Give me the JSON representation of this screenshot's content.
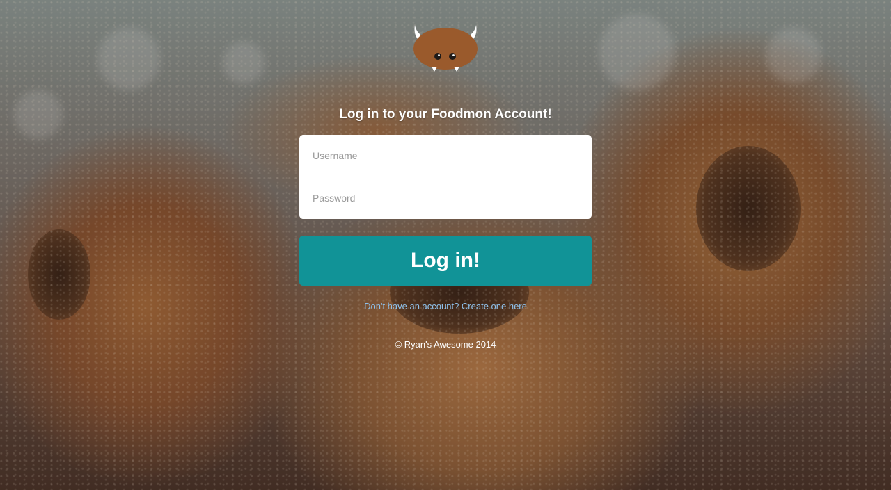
{
  "login": {
    "title": "Log in to your Foodmon Account!",
    "username_placeholder": "Username",
    "password_placeholder": "Password",
    "submit_label": "Log in!",
    "signup_link": "Don't have an account? Create one here"
  },
  "footer": {
    "copyright": "© Ryan's Awesome 2014"
  },
  "logo": {
    "icon": "horned-monster-icon"
  },
  "colors": {
    "button": "#119397",
    "link": "#8ec0ea",
    "logo_body": "#9a5a2c"
  }
}
